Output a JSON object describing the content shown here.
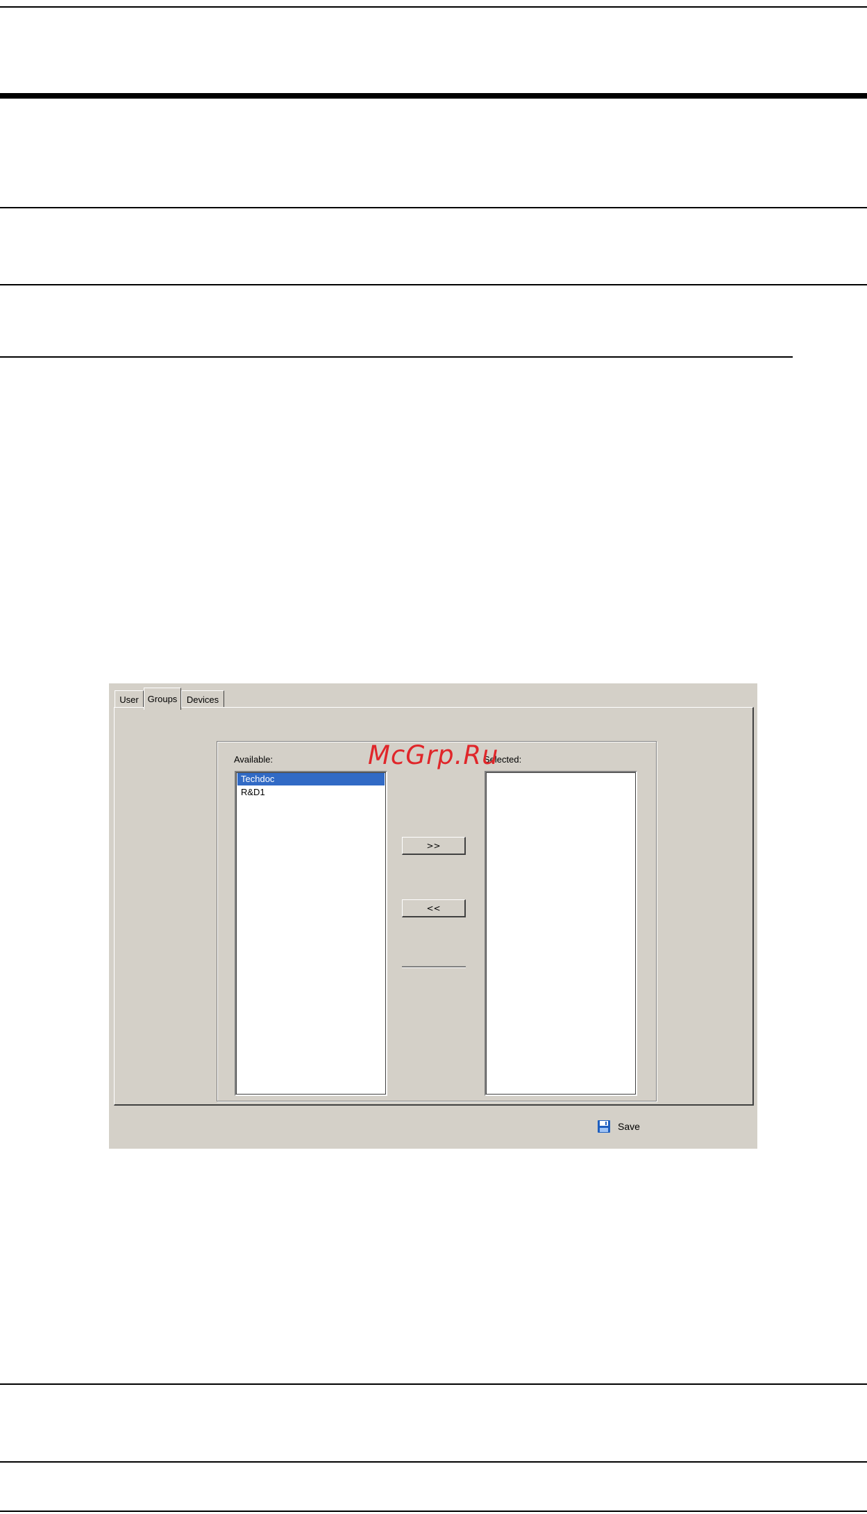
{
  "dialog": {
    "tabs": [
      {
        "label": "User"
      },
      {
        "label": "Groups"
      },
      {
        "label": "Devices"
      }
    ],
    "active_tab": "Groups",
    "available_label": "Available:",
    "selected_label": "Selected:",
    "available_items": [
      "Techdoc",
      "R&D1"
    ],
    "selected_items": [],
    "add_button": ">>",
    "remove_button": "<<",
    "save_label": "Save"
  },
  "watermark": "McGrp.Ru",
  "colors": {
    "dialog_bg": "#d4d0c8",
    "selection": "#316ac5",
    "watermark": "#e0262a"
  }
}
